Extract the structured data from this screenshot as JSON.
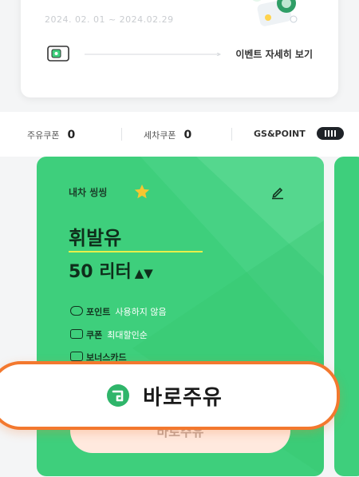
{
  "event": {
    "date_range": "2024. 02. 01 ~ 2024.02.29",
    "detail_link": "이벤트 자세히 보기"
  },
  "points_bar": {
    "fuel_coupon_label": "주유쿠폰",
    "fuel_coupon_count": "0",
    "wash_coupon_label": "세차쿠폰",
    "wash_coupon_count": "0",
    "gs_point_label": "GS&POINT"
  },
  "fuel_card": {
    "car_name": "내차 씽씽",
    "fuel_type": "휘발유",
    "amount": "50 리터",
    "options": [
      {
        "key": "포인트",
        "value": "사용하지 않음"
      },
      {
        "key": "쿠폰",
        "value": "최대할인순"
      },
      {
        "key": "보너스카드",
        "value": ""
      }
    ],
    "ghost_button_label": "바로주유"
  },
  "quick_fuel_button": {
    "label": "바로주유"
  },
  "colors": {
    "card_green": "#3ecf7c",
    "highlight_orange": "#f3782e",
    "star_yellow": "#f6c631"
  }
}
